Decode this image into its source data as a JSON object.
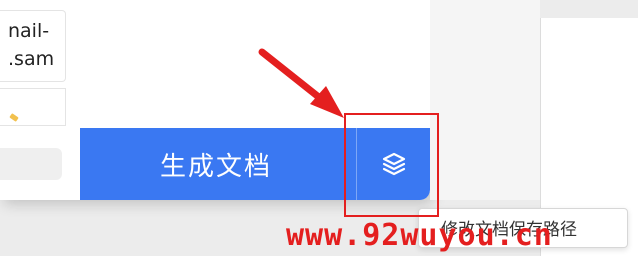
{
  "email_card": {
    "line1": "nail-",
    "line2": ".sam"
  },
  "footer": {
    "generate_label": "生成文档",
    "layers_icon": "layers-icon"
  },
  "tooltip": {
    "text": "修改文档保存路径"
  },
  "annotation": {
    "arrow_color": "#e41f1f",
    "box_color": "#e41f1f"
  },
  "watermark": {
    "text": "www.92wuyou.cn",
    "color": "#e41f1f"
  },
  "colors": {
    "accent": "#3a78f2",
    "background": "#ececec"
  }
}
